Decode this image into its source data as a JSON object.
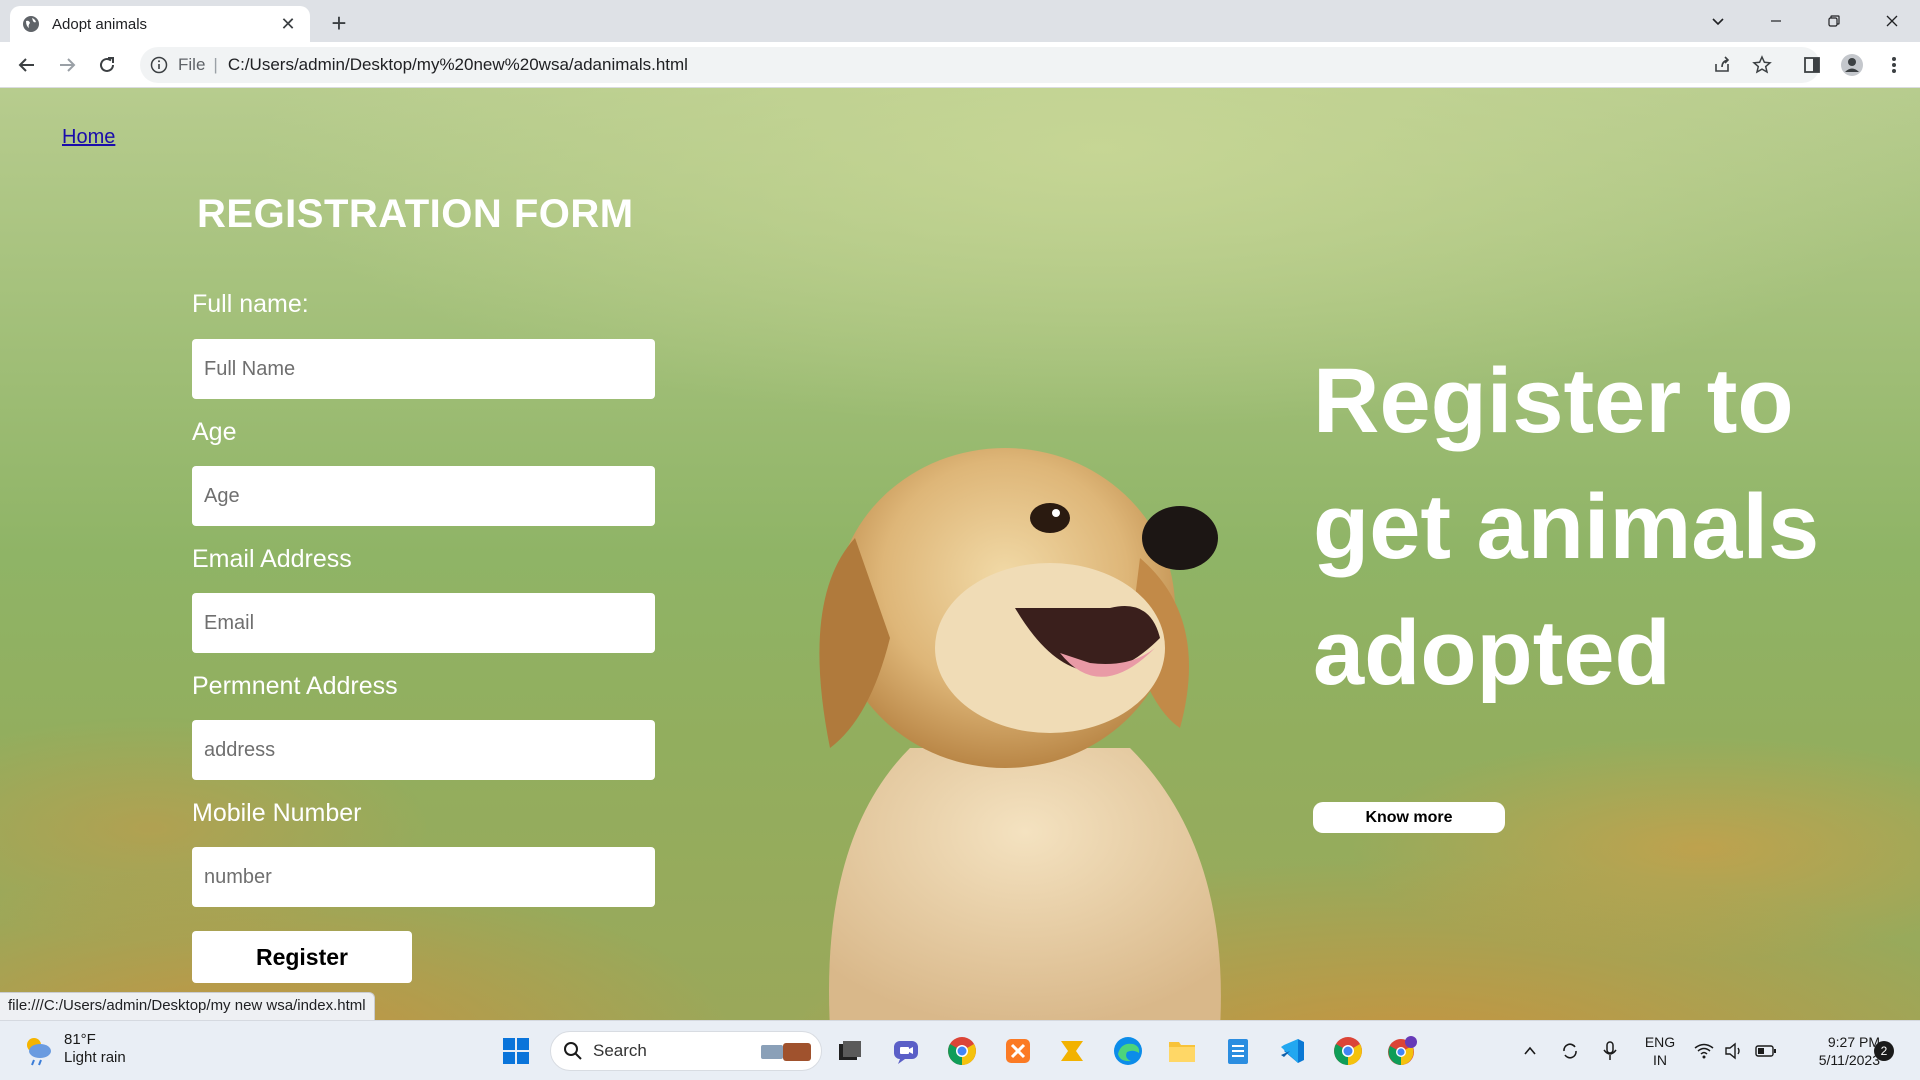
{
  "browser": {
    "tab_title": "Adopt animals",
    "tab_close": "✕",
    "new_tab": "+",
    "address_scheme": "File",
    "address_url": "C:/Users/admin/Desktop/my%20new%20wsa/adanimals.html",
    "status_url": "file:///C:/Users/admin/Desktop/my new wsa/index.html"
  },
  "page": {
    "home_link": "Home",
    "form_title": "REGISTRATION FORM",
    "fields": [
      {
        "label": "Full name:",
        "placeholder": "Full Name"
      },
      {
        "label": "Age",
        "placeholder": "Age"
      },
      {
        "label": "Email Address",
        "placeholder": "Email"
      },
      {
        "label": "Permnent Address",
        "placeholder": "address"
      },
      {
        "label": "Mobile Number",
        "placeholder": "number"
      }
    ],
    "register_button": "Register",
    "hero_text": "Register to get animals adopted",
    "know_more_button": "Know more"
  },
  "taskbar": {
    "weather_temp": "81°F",
    "weather_desc": "Light rain",
    "search_label": "Search",
    "language_line1": "ENG",
    "language_line2": "IN",
    "time": "9:27 PM",
    "date": "5/11/2023",
    "notification_count": "2"
  },
  "icons": [
    "globe-icon",
    "back-icon",
    "forward-icon",
    "reload-icon",
    "info-icon",
    "share-icon",
    "star-icon",
    "sidepanel-icon",
    "profile-icon",
    "menu-icon",
    "windows-start-icon",
    "search-icon",
    "chrome-icon",
    "vscode-icon",
    "edge-icon",
    "explorer-icon",
    "wifi-icon",
    "volume-icon",
    "battery-icon"
  ],
  "colors": {
    "link": "#1a0dab",
    "hero_text": "#ffffff",
    "tabbar": "#dee1e6",
    "taskbar": "#e9eef5"
  }
}
